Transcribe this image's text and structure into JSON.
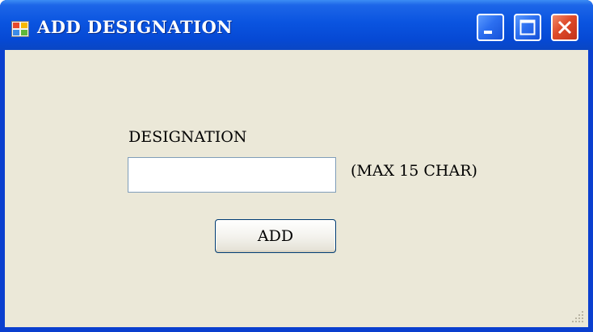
{
  "window": {
    "title": "ADD DESIGNATION",
    "icon": "app-window-icon",
    "controls": {
      "minimize_icon": "minimize-icon",
      "maximize_icon": "maximize-icon",
      "close_icon": "close-icon"
    },
    "colors": {
      "titlebar": "#0a54e0",
      "client_background": "#ebe8d8",
      "close_button": "#de4a2a"
    }
  },
  "form": {
    "designation_label": "DESIGNATION",
    "designation_value": "",
    "designation_placeholder": "",
    "hint": "(MAX 15 CHAR)",
    "add_label": "ADD"
  }
}
